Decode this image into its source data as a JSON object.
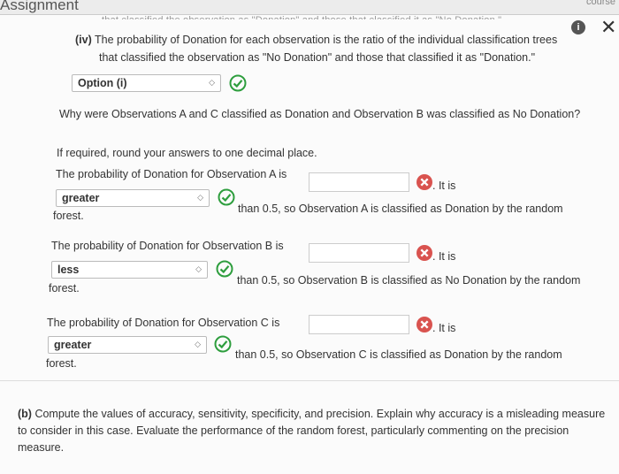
{
  "header": {
    "title": "Assignment",
    "right_text": "course"
  },
  "clipped_text": "that classified the observation as \"Donation\" and those that classified it as \"No Donation.\"",
  "icons": {
    "info": "i",
    "close": "✕"
  },
  "colors": {
    "check_green": "#2e9e3e",
    "error_red": "#d9534f"
  },
  "part_iv": {
    "label": "(iv)",
    "line1": "The probability of Donation for each observation is the ratio of the individual classification trees",
    "line2": "that classified the observation as \"No Donation\" and those that classified it as \"Donation.\"",
    "select_value": "Option (i)"
  },
  "question": "Why were Observations A and C classified as Donation and Observation B was classified as No Donation?",
  "round_note": "If required, round your answers to one decimal place.",
  "obs_a": {
    "prefix": "The probability of Donation for Observation A is",
    "input_value": "",
    "it_is": ". It is",
    "select_value": "greater",
    "suffix": "than 0.5, so Observation A is classified as Donation by the random",
    "forest": "forest."
  },
  "obs_b": {
    "prefix": "The probability of Donation for Observation B is",
    "input_value": "",
    "it_is": ". It is",
    "select_value": "less",
    "suffix": "than 0.5, so Observation B is classified as No Donation by the random",
    "forest": "forest."
  },
  "obs_c": {
    "prefix": "The probability of Donation for Observation C is",
    "input_value": "",
    "it_is": ". It is",
    "select_value": "greater",
    "suffix": "than 0.5, so Observation C is classified as Donation by the random",
    "forest": "forest."
  },
  "part_b": {
    "label": "(b)",
    "text": "Compute the values of accuracy, sensitivity, specificity, and precision. Explain why accuracy is a misleading measure to consider in this case. Evaluate the performance of the random forest, particularly commenting on the precision measure."
  }
}
